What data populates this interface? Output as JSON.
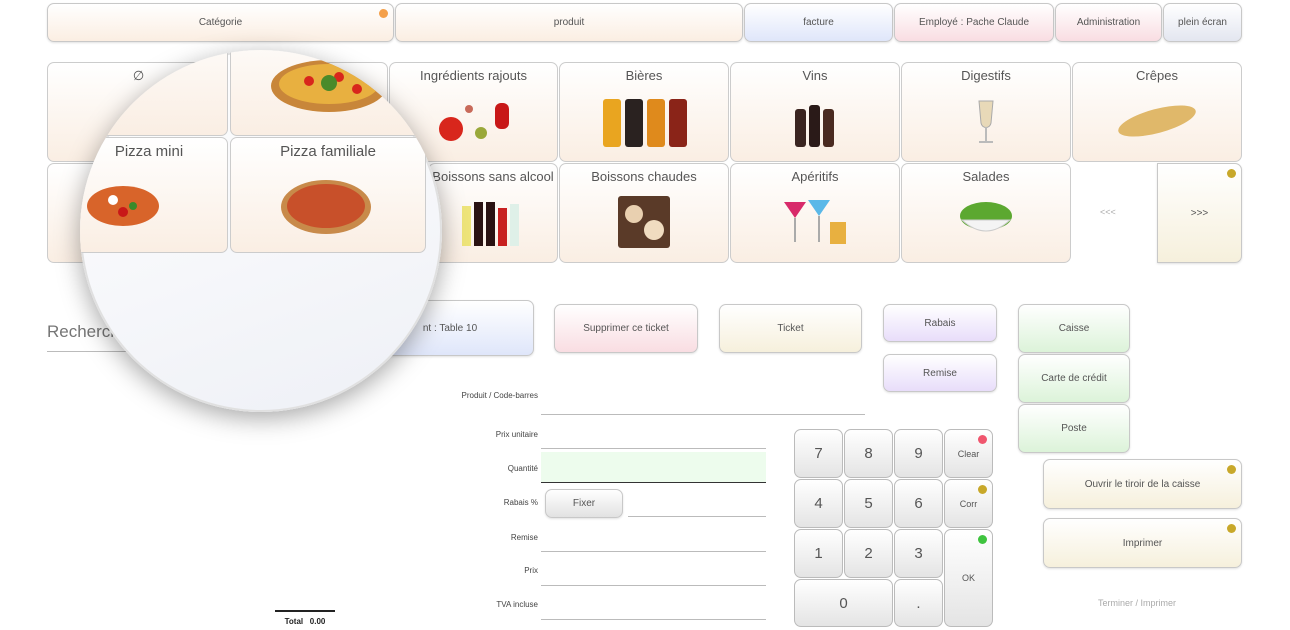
{
  "top_tabs": [
    {
      "label": "Catégorie",
      "dot": "#f4a04a"
    },
    {
      "label": "produit"
    },
    {
      "label": "facture"
    },
    {
      "label": "Employé : Pache Claude"
    },
    {
      "label": "Administration"
    },
    {
      "label": "plein écran"
    }
  ],
  "categories": [
    {
      "label": "∅"
    },
    {
      "label": "Ingrédients rajouts",
      "icon": "vegetables-icon"
    },
    {
      "label": "Bières",
      "icon": "beer-glasses-icon"
    },
    {
      "label": "Vins",
      "icon": "wine-bottles-icon"
    },
    {
      "label": "Digestifs",
      "icon": "digestif-glass-icon"
    },
    {
      "label": "Crêpes",
      "icon": "crepes-icon"
    },
    {
      "label": "Boissons sans alcool",
      "icon": "soft-drinks-icon"
    },
    {
      "label": "Boissons chaudes",
      "icon": "hot-drinks-icon"
    },
    {
      "label": "Apéritifs",
      "icon": "cocktail-icon"
    },
    {
      "label": "Salades",
      "icon": "salad-icon"
    }
  ],
  "magnified": {
    "pizza_mini": "Pizza mini",
    "pizza_familiale": "Pizza familiale"
  },
  "pager": {
    "prev": "<<<",
    "next": ">>>",
    "next_dot": "#c8a82a"
  },
  "search": {
    "placeholder": "Rechercher par désignation"
  },
  "actions": {
    "client": "nt : Table 10",
    "delete": "Supprimer ce ticket",
    "ticket": "Ticket",
    "rabais": "Rabais",
    "remise": "Remise"
  },
  "form": {
    "produit": "Produit / Code-barres",
    "prix_unitaire": "Prix unitaire",
    "quantite": "Quantité",
    "rabais": "Rabais %",
    "fixer": "Fixer",
    "remise": "Remise",
    "prix": "Prix",
    "tva": "TVA incluse"
  },
  "keypad": {
    "keys": [
      "7",
      "8",
      "9",
      "4",
      "5",
      "6",
      "1",
      "2",
      "3",
      "0",
      "."
    ],
    "clear": "Clear",
    "corr": "Corr",
    "ok": "OK",
    "clear_dot": "#f0566e",
    "corr_dot": "#c8a82a",
    "ok_dot": "#3fc43f"
  },
  "payment": {
    "caisse": "Caisse",
    "carte": "Carte de crédit",
    "poste": "Poste",
    "tiroir": "Ouvrir le tiroir de la caisse",
    "imprimer": "Imprimer",
    "terminer": "Terminer / Imprimer"
  },
  "total": {
    "label": "Total",
    "value": "0.00"
  }
}
